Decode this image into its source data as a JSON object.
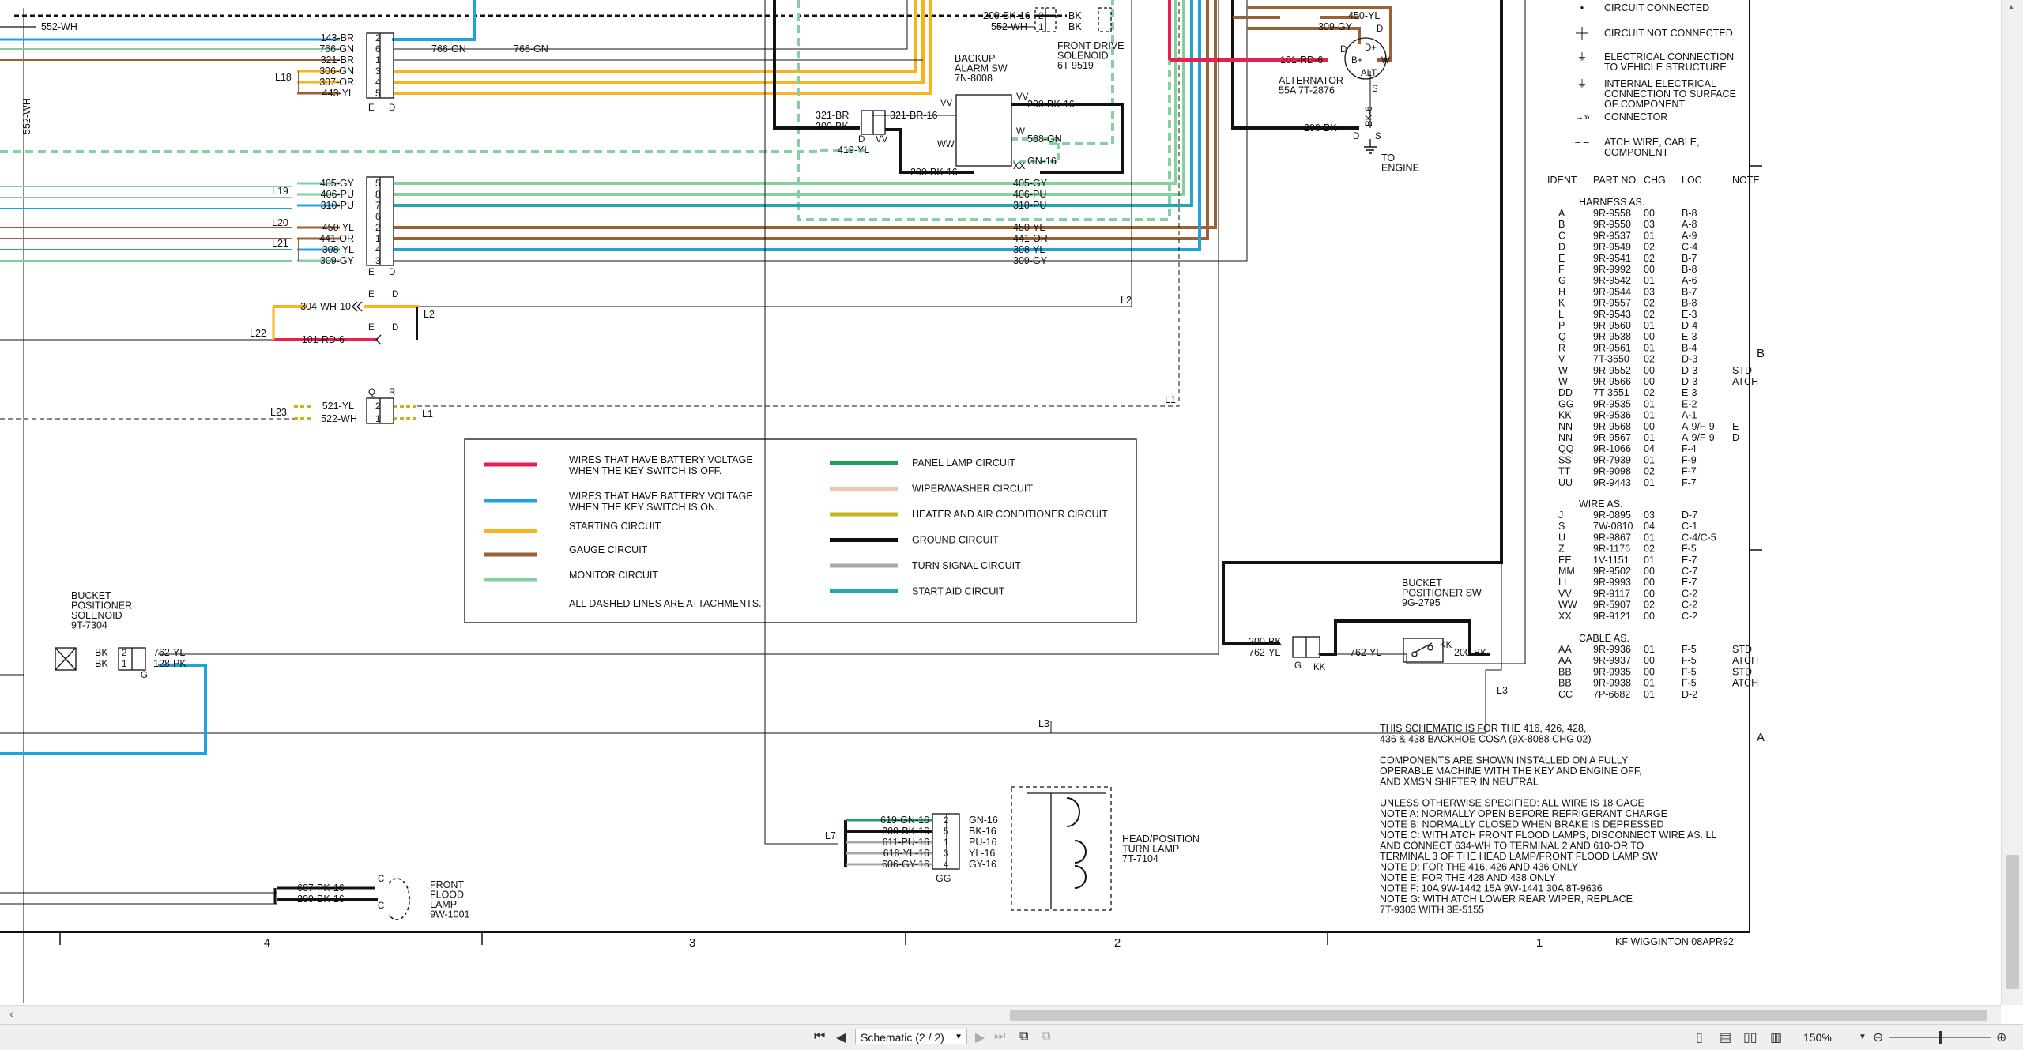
{
  "viewer": {
    "page_selector": "Schematic (2 / 2)",
    "zoom": "150%"
  },
  "legend": {
    "items_left": [
      {
        "color": "#e8204f",
        "text1": "WIRES THAT HAVE BATTERY VOLTAGE",
        "text2": "WHEN THE KEY SWITCH IS OFF."
      },
      {
        "color": "#1ca3e0",
        "text1": "WIRES THAT HAVE BATTERY VOLTAGE",
        "text2": "WHEN THE KEY SWITCH IS ON."
      },
      {
        "color": "#f7b41f",
        "text1": "STARTING CIRCUIT",
        "text2": ""
      },
      {
        "color": "#9b6033",
        "text1": "GAUGE CIRCUIT",
        "text2": ""
      },
      {
        "color": "#86cfa0",
        "text1": "MONITOR CIRCUIT",
        "text2": ""
      }
    ],
    "items_right": [
      {
        "color": "#1fa15a",
        "text": "PANEL LAMP CIRCUIT"
      },
      {
        "color": "#e9c6b0",
        "text": "WIPER/WASHER CIRCUIT"
      },
      {
        "color": "#c8b31a",
        "text": "HEATER AND AIR CONDITIONER CIRCUIT"
      },
      {
        "color": "#111111",
        "text": "GROUND CIRCUIT"
      },
      {
        "color": "#a8a8a8",
        "text": "TURN SIGNAL CIRCUIT"
      },
      {
        "color": "#22a8b5",
        "text": "START AID CIRCUIT"
      }
    ],
    "dashed_note": "ALL DASHED LINES ARE ATTACHMENTS."
  },
  "symbols": [
    {
      "glyph": "•",
      "text": [
        "CIRCUIT CONNECTED"
      ]
    },
    {
      "glyph": "",
      "text": [
        "CIRCUIT NOT CONNECTED"
      ]
    },
    {
      "glyph": "⏚",
      "text": [
        "ELECTRICAL CONNECTION",
        "TO VEHICLE STRUCTURE"
      ]
    },
    {
      "glyph": "⏚",
      "text": [
        "INTERNAL ELECTRICAL",
        "CONNECTION TO SURFACE",
        "OF COMPONENT"
      ]
    },
    {
      "glyph": "→»",
      "text": [
        "CONNECTOR"
      ]
    },
    {
      "glyph": "– –",
      "text": [
        "ATCH WIRE, CABLE,",
        "COMPONENT"
      ]
    }
  ],
  "parts": {
    "headers": [
      "IDENT",
      "PART NO.",
      "CHG",
      "LOC",
      "NOTE"
    ],
    "harness_title": "HARNESS AS.",
    "harness": [
      [
        "A",
        "9R-9558",
        "00",
        "B-8",
        ""
      ],
      [
        "B",
        "9R-9550",
        "03",
        "A-8",
        ""
      ],
      [
        "C",
        "9R-9537",
        "01",
        "A-9",
        ""
      ],
      [
        "D",
        "9R-9549",
        "02",
        "C-4",
        ""
      ],
      [
        "E",
        "9R-9541",
        "02",
        "B-7",
        ""
      ],
      [
        "F",
        "9R-9992",
        "00",
        "B-8",
        ""
      ],
      [
        "G",
        "9R-9542",
        "01",
        "A-6",
        ""
      ],
      [
        "H",
        "9R-9544",
        "03",
        "B-7",
        ""
      ],
      [
        "K",
        "9R-9557",
        "02",
        "B-8",
        ""
      ],
      [
        "L",
        "9R-9543",
        "02",
        "E-3",
        ""
      ],
      [
        "P",
        "9R-9560",
        "01",
        "D-4",
        ""
      ],
      [
        "Q",
        "9R-9538",
        "00",
        "E-3",
        ""
      ],
      [
        "R",
        "9R-9561",
        "01",
        "B-4",
        ""
      ],
      [
        "V",
        "7T-3550",
        "02",
        "D-3",
        ""
      ],
      [
        "W",
        "9R-9552",
        "00",
        "D-3",
        "STD"
      ],
      [
        "W",
        "9R-9566",
        "00",
        "D-3",
        "ATCH"
      ],
      [
        "DD",
        "7T-3551",
        "02",
        "E-3",
        ""
      ],
      [
        "GG",
        "9R-9535",
        "01",
        "E-2",
        ""
      ],
      [
        "KK",
        "9R-9536",
        "01",
        "A-1",
        ""
      ],
      [
        "NN",
        "9R-9568",
        "00",
        "A-9/F-9",
        "E"
      ],
      [
        "NN",
        "9R-9567",
        "01",
        "A-9/F-9",
        "D"
      ],
      [
        "QQ",
        "9R-1066",
        "04",
        "F-4",
        ""
      ],
      [
        "SS",
        "9R-7939",
        "01",
        "F-9",
        ""
      ],
      [
        "TT",
        "9R-9098",
        "02",
        "F-7",
        ""
      ],
      [
        "UU",
        "9R-9443",
        "01",
        "F-7",
        ""
      ]
    ],
    "wire_title": "WIRE AS.",
    "wire": [
      [
        "J",
        "9R-0895",
        "03",
        "D-7",
        ""
      ],
      [
        "S",
        "7W-0810",
        "04",
        "C-1",
        ""
      ],
      [
        "U",
        "9R-9867",
        "01",
        "C-4/C-5",
        ""
      ],
      [
        "Z",
        "9R-1176",
        "02",
        "F-5",
        ""
      ],
      [
        "EE",
        "1V-1151",
        "01",
        "E-7",
        ""
      ],
      [
        "MM",
        "9R-9502",
        "00",
        "C-7",
        ""
      ],
      [
        "LL",
        "9R-9993",
        "00",
        "E-7",
        ""
      ],
      [
        "VV",
        "9R-9117",
        "00",
        "C-2",
        ""
      ],
      [
        "WW",
        "9R-5907",
        "02",
        "C-2",
        ""
      ],
      [
        "XX",
        "9R-9121",
        "00",
        "C-2",
        ""
      ]
    ],
    "cable_title": "CABLE AS.",
    "cable": [
      [
        "AA",
        "9R-9936",
        "01",
        "F-5",
        "STD"
      ],
      [
        "AA",
        "9R-9937",
        "00",
        "F-5",
        "ATCH"
      ],
      [
        "BB",
        "9R-9935",
        "00",
        "F-5",
        "STD"
      ],
      [
        "BB",
        "9R-9938",
        "01",
        "F-5",
        "ATCH"
      ],
      [
        "CC",
        "7P-6682",
        "01",
        "D-2",
        ""
      ]
    ]
  },
  "notes": [
    "THIS SCHEMATIC IS FOR THE 416, 426, 428,",
    "436 & 438 BACKHOE COSA (9X-8088 CHG 02)",
    "",
    "COMPONENTS ARE SHOWN INSTALLED ON A FULLY",
    "OPERABLE MACHINE WITH THE KEY AND ENGINE OFF,",
    "AND XMSN SHIFTER IN NEUTRAL",
    "",
    "UNLESS OTHERWISE SPECIFIED: ALL WIRE IS 18 GAGE",
    "NOTE A: NORMALLY OPEN BEFORE REFRIGERANT CHARGE",
    "NOTE B: NORMALLY CLOSED WHEN BRAKE IS DEPRESSED",
    "NOTE C: WITH ATCH FRONT FLOOD LAMPS, DISCONNECT WIRE AS. LL",
    "            AND CONNECT 634-WH TO TERMINAL 2 AND 610-OR TO",
    "            TERMINAL 3 OF THE HEAD LAMP/FRONT FLOOD LAMP SW",
    "NOTE D: FOR THE 416, 426 AND 436 ONLY",
    "NOTE E: FOR THE 428 AND 438 ONLY",
    "NOTE F: 10A 9W-1442 15A 9W-1441 30A 8T-9636",
    "NOTE G: WITH ATCH LOWER REAR WIPER, REPLACE",
    "            7T-9303 WITH 3E-5155"
  ],
  "signature": "KF WIGGINTON 08APR92",
  "grid_columns": [
    "4",
    "3",
    "2",
    "1"
  ],
  "grid_rows": [
    "B",
    "A"
  ],
  "components": {
    "backup_alarm": [
      "BACKUP",
      "ALARM SW",
      "7N-8008"
    ],
    "front_drive": [
      "FRONT DRIVE",
      "SOLENOID",
      "6T-9519"
    ],
    "alternator": [
      "ALTERNATOR",
      "55A 7T-2876"
    ],
    "to_engine": [
      "TO",
      "ENGINE"
    ],
    "bucket_solenoid": [
      "BUCKET",
      "POSITIONER",
      "SOLENOID",
      "9T-7304"
    ],
    "bucket_sw": [
      "BUCKET",
      "POSITIONER SW",
      "9G-2795"
    ],
    "head_lamp": [
      "HEAD/POSITION",
      "TURN LAMP",
      "7T-7104"
    ],
    "flood_lamp": [
      "FRONT",
      "FLOOD",
      "LAMP",
      "9W-1001"
    ]
  },
  "connector_L18": {
    "id": "L18",
    "wires": [
      "143-BR",
      "766-GN",
      "321-BR",
      "306-GN",
      "307-OR",
      "443-YL"
    ],
    "pins": [
      "2",
      "6",
      "1",
      "3",
      "4",
      "5"
    ],
    "ends": [
      "E",
      "D"
    ]
  },
  "connector_L19": {
    "id": "L19",
    "wires": [
      "405-GY",
      "406-PU",
      "310-PU"
    ],
    "pins": [
      "5",
      "8",
      "7"
    ]
  },
  "connector_L20": {
    "id": "L20",
    "wires": [
      "450-YL"
    ],
    "pins": [
      "6",
      "2"
    ]
  },
  "connector_L21": {
    "id": "L21",
    "wires": [
      "441-OR",
      "308-YL",
      "309-GY"
    ],
    "pins": [
      "1",
      "4",
      "3"
    ],
    "ends": [
      "E",
      "D"
    ]
  },
  "connector_L22": {
    "id": "L22",
    "wires": [
      "304-WH-10",
      "101-RD-6"
    ],
    "ends": [
      "E",
      "D"
    ],
    "tag": "L2"
  },
  "connector_L23": {
    "id": "L23",
    "wires": [
      "521-YL",
      "522-WH"
    ],
    "pins": [
      "2",
      "1"
    ],
    "ends": [
      "Q",
      "R"
    ],
    "tag": "L1"
  },
  "right_wires_L19": [
    "405-GY",
    "406-PU",
    "310-PU"
  ],
  "right_wires_L21": [
    "450-YL",
    "441-OR",
    "308-YL",
    "309-GY"
  ],
  "labels": {
    "w552": "552-WH",
    "w552v": "552-WH",
    "w766a": "766-GN",
    "w766b": "766-GN",
    "w200bk16_top": "200-BK-16",
    "w552wh_top": "552-WH",
    "bk1": "BK",
    "bk2": "BK",
    "p1": "1",
    "p2": "2",
    "alt_450": "450-YL",
    "alt_309": "309-GY",
    "alt_101": "101-RD-6",
    "alt_d1": "D",
    "alt_d2": "D",
    "alt_w": "W",
    "alt_bplus": "B+",
    "alt_dplus": "D+",
    "alt_alt": "ALT",
    "alt_s": "S",
    "alt_200": "200-BK",
    "alt_bk6": "BK-6",
    "alt_d3": "D",
    "alt_s2": "S",
    "ba_321br": "321-BR",
    "ba_200bk": "200-BK",
    "ba_321br16": "321-BR-16",
    "ba_419": "419-YL",
    "ba_200bk16": "200-BK-16",
    "ba_200bk16b": "200-BK-16",
    "ba_568": "568-GN",
    "ba_gn16": "GN-16",
    "ba_vv": "VV",
    "ba_vv2": "VV",
    "ba_ww": "WW",
    "ba_w": "W",
    "ba_xx": "XX",
    "ba_d": "D",
    "ba_vv3": "VV",
    "bs_200bk": "200-BK",
    "bs_762yl": "762-YL",
    "bs_762yl2": "762-YL",
    "bs_200bk2": "200-BK",
    "bs_kk": "KK",
    "bs_kk2": "KK",
    "bs_g": "G",
    "l3a": "L3",
    "l3b": "L3",
    "sol_bk1": "BK",
    "sol_bk2": "BK",
    "sol_762": "762-YL",
    "sol_128": "128-PK",
    "sol_g": "G",
    "hl_l7": "L7",
    "hl_gg": "GG",
    "fl_607": "607-PK-16",
    "fl_200": "200-BK-16",
    "fl_c1": "C",
    "fl_c2": "C",
    "l2": "L2",
    "l1": "L1"
  },
  "head_lamp_wires": [
    {
      "left": "619-GN-16",
      "pin": "2",
      "right": "GN-16"
    },
    {
      "left": "200-BK-16",
      "pin": "5",
      "right": "BK-16"
    },
    {
      "left": "611-PU-16",
      "pin": "1",
      "right": "PU-16"
    },
    {
      "left": "618-YL-16",
      "pin": "3",
      "right": "YL-16"
    },
    {
      "left": "606-GY-16",
      "pin": "4",
      "right": "GY-16"
    }
  ]
}
